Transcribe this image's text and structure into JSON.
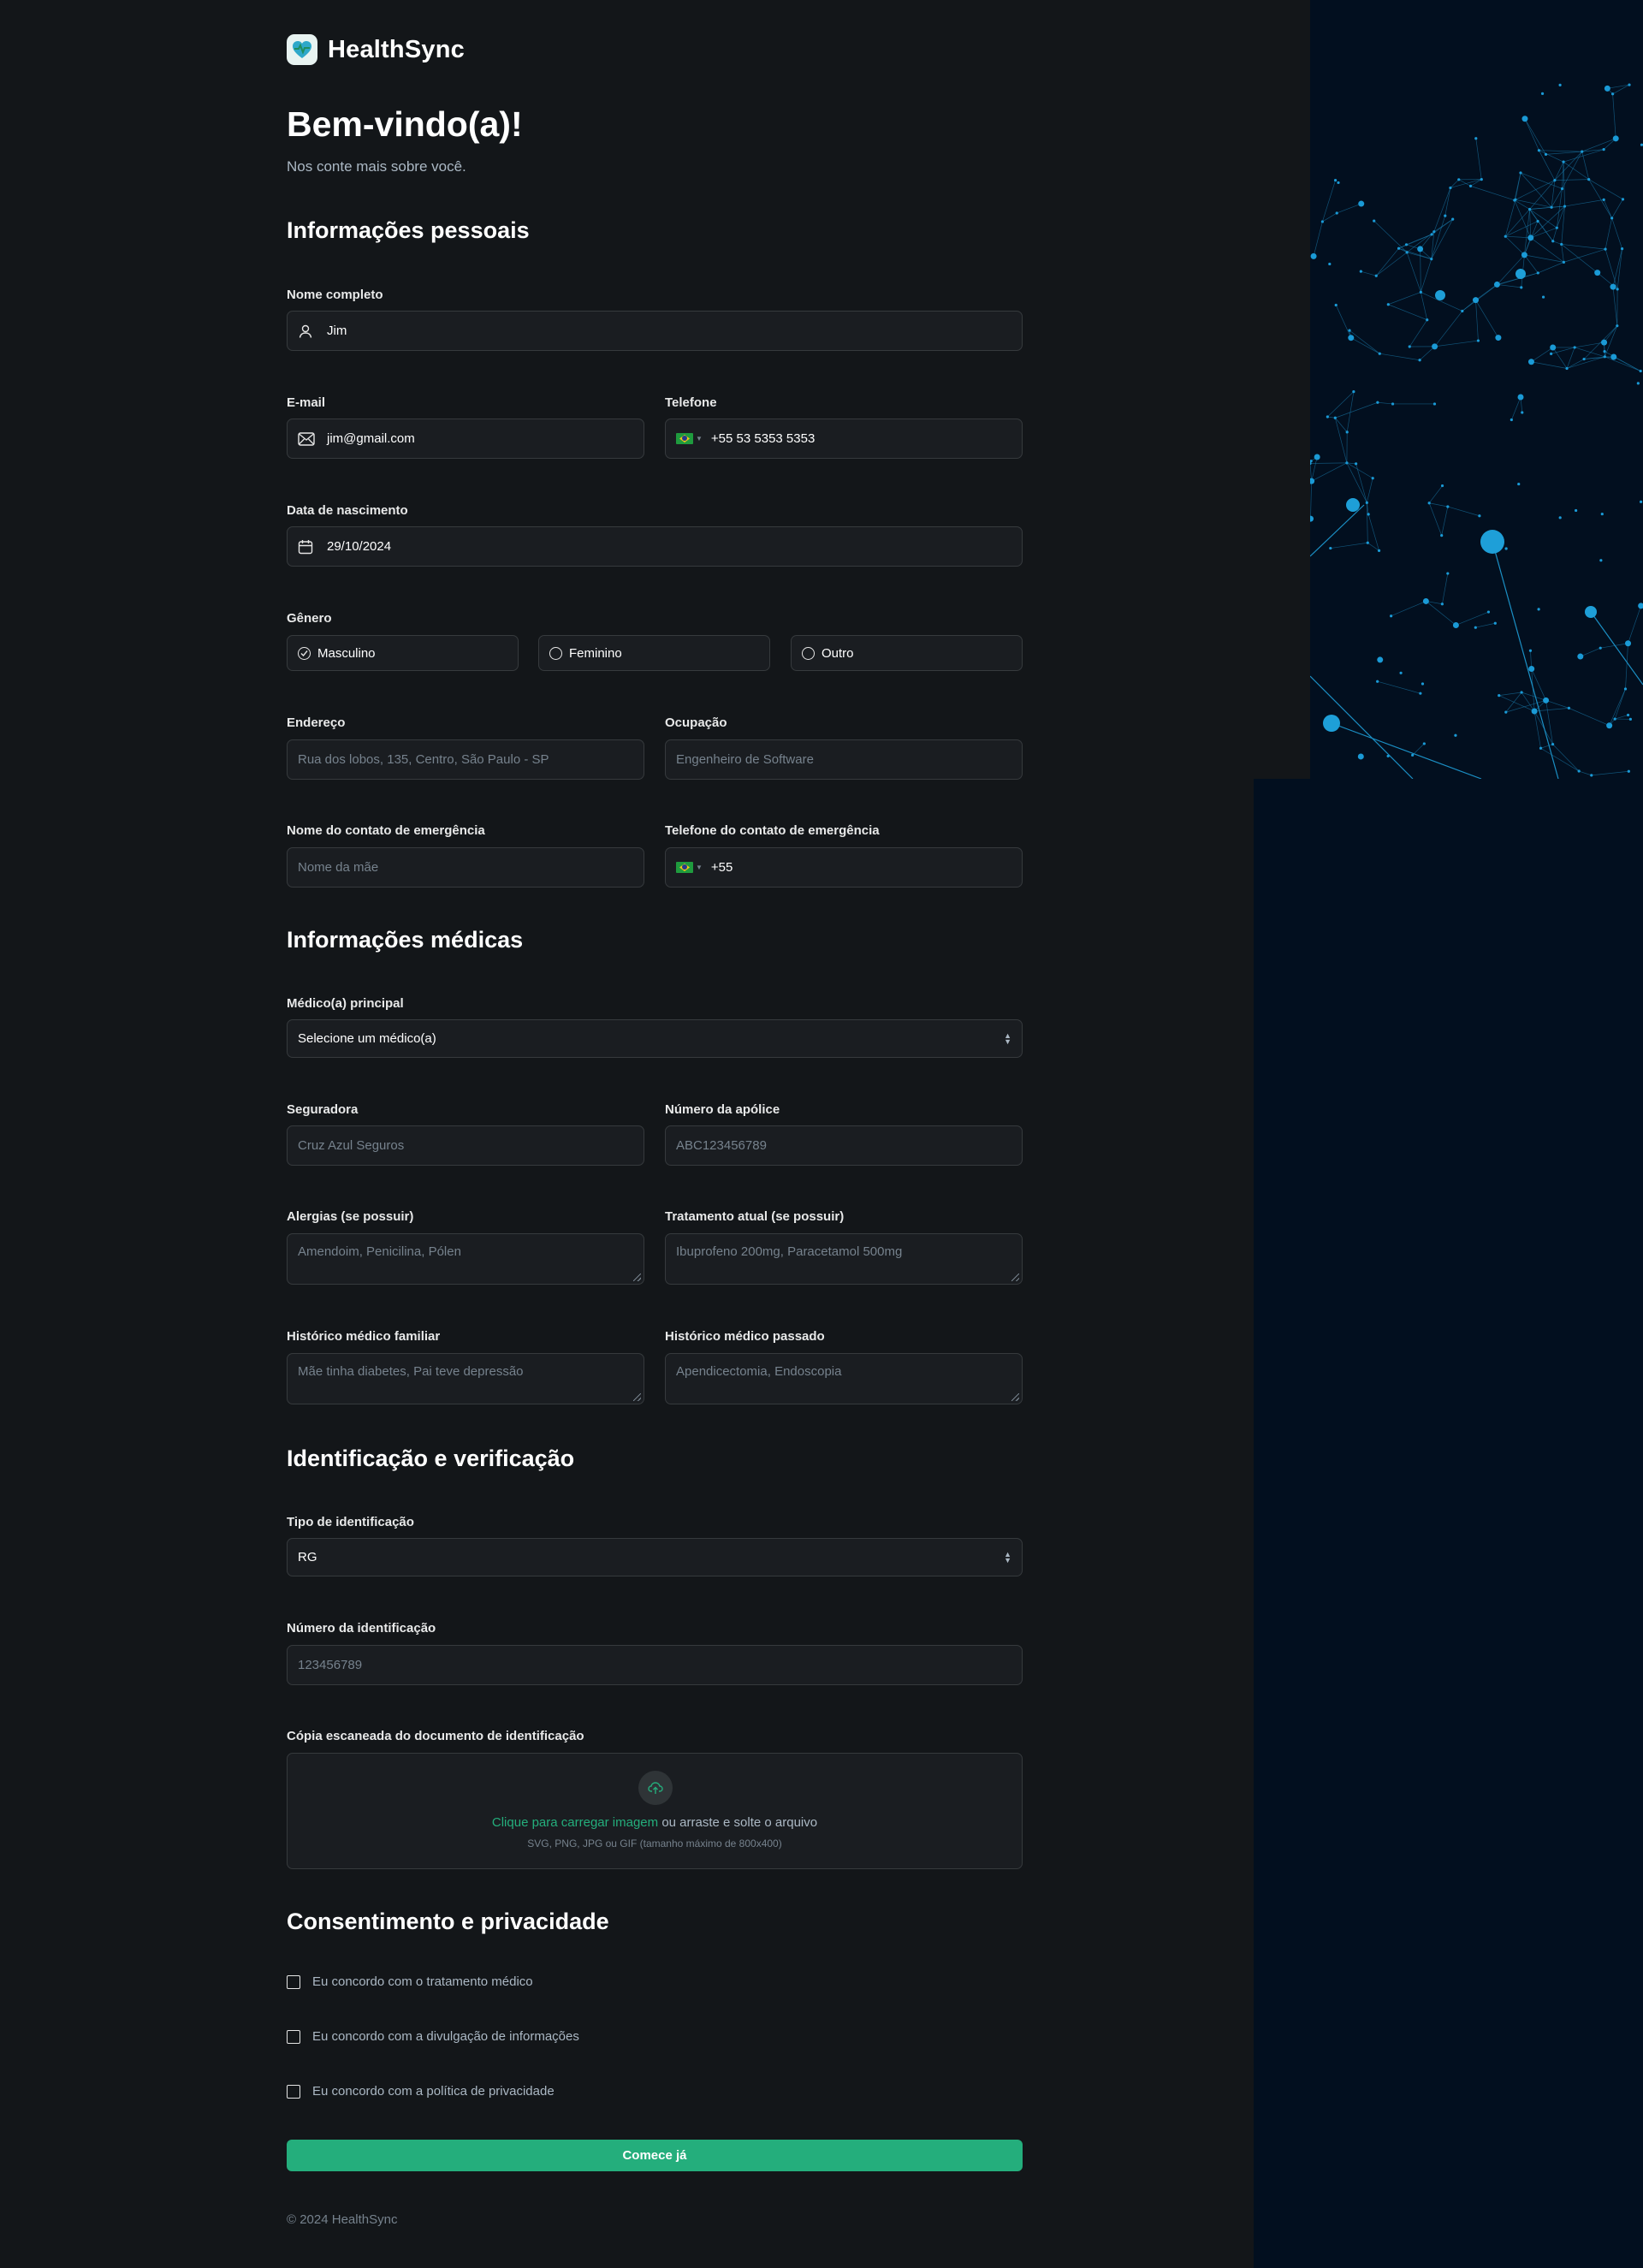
{
  "brand": {
    "name": "HealthSync",
    "accent": "#24ae7c"
  },
  "header": {
    "title": "Bem-vindo(a)!",
    "subtitle": "Nos conte mais sobre você."
  },
  "personal": {
    "section_title": "Informações pessoais",
    "name": {
      "label": "Nome completo",
      "value": "Jim",
      "icon": "user-icon"
    },
    "email": {
      "label": "E-mail",
      "value": "jim@gmail.com",
      "icon": "mail-icon"
    },
    "phone": {
      "label": "Telefone",
      "value": "+55 53 5353 5353",
      "flag": "brazil-flag-icon"
    },
    "birthdate": {
      "label": "Data de nascimento",
      "value": "29/10/2024",
      "icon": "calendar-icon"
    },
    "gender": {
      "label": "Gênero",
      "options": [
        "Masculino",
        "Feminino",
        "Outro"
      ],
      "selected": "Masculino"
    },
    "address": {
      "label": "Endereço",
      "placeholder": "Rua dos lobos, 135, Centro, São Paulo - SP"
    },
    "occupation": {
      "label": "Ocupação",
      "placeholder": "Engenheiro de Software"
    },
    "emergency_name": {
      "label": "Nome do contato de emergência",
      "placeholder": "Nome da mãe"
    },
    "emergency_phone": {
      "label": "Telefone do contato de emergência",
      "value": "+55"
    }
  },
  "medical": {
    "section_title": "Informações médicas",
    "doctor": {
      "label": "Médico(a) principal",
      "value": "Selecione um médico(a)"
    },
    "insurer": {
      "label": "Seguradora",
      "placeholder": "Cruz Azul Seguros"
    },
    "policy": {
      "label": "Número da apólice",
      "placeholder": "ABC123456789"
    },
    "allergies": {
      "label": "Alergias (se possuir)",
      "placeholder": "Amendoim, Penicilina, Pólen"
    },
    "treatment": {
      "label": "Tratamento atual (se possuir)",
      "placeholder": "Ibuprofeno 200mg, Paracetamol 500mg"
    },
    "family_history": {
      "label": "Histórico médico familiar",
      "placeholder": "Mãe tinha diabetes, Pai teve depressão"
    },
    "past_history": {
      "label": "Histórico médico passado",
      "placeholder": "Apendicectomia, Endoscopia"
    }
  },
  "identification": {
    "section_title": "Identificação e verificação",
    "type": {
      "label": "Tipo de identificação",
      "value": "RG"
    },
    "number": {
      "label": "Número da identificação",
      "placeholder": "123456789"
    },
    "upload": {
      "label": "Cópia escaneada do documento de identificação",
      "link_text": "Clique para carregar imagem",
      "rest_text": " ou arraste e solte o arquivo",
      "hint": "SVG, PNG, JPG ou GIF (tamanho máximo de 800x400)"
    }
  },
  "consent": {
    "section_title": "Consentimento e privacidade",
    "items": [
      "Eu concordo com o tratamento médico",
      "Eu concordo com a divulgação de informações",
      "Eu concordo com a política de privacidade"
    ]
  },
  "submit_label": "Comece já",
  "footer": "© 2024 HealthSync"
}
